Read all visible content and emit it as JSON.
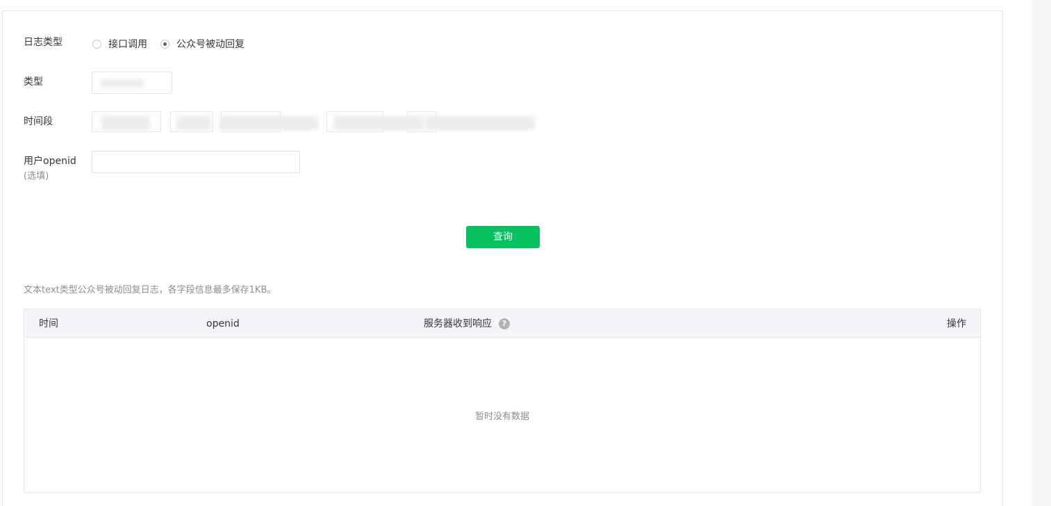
{
  "form": {
    "log_type_label": "日志类型",
    "log_type_options": [
      {
        "label": "接口调用",
        "selected": false
      },
      {
        "label": "公众号被动回复",
        "selected": true
      }
    ],
    "type_label": "类型",
    "time_range_label": "时间段",
    "openid_label": "用户openid",
    "openid_optional": "(选填)",
    "openid_value": "",
    "query_button": "查询"
  },
  "tip": "文本text类型公众号被动回复日志，各字段信息最多保存1KB。",
  "table": {
    "columns": [
      "时间",
      "openid",
      "服务器收到响应",
      "操作"
    ],
    "empty_text": "暂时没有数据"
  },
  "colors": {
    "primary": "#07c160",
    "header_bg": "#f4f5f9",
    "border": "#e7e7eb"
  },
  "icons": {
    "help": "question-circle-icon"
  }
}
